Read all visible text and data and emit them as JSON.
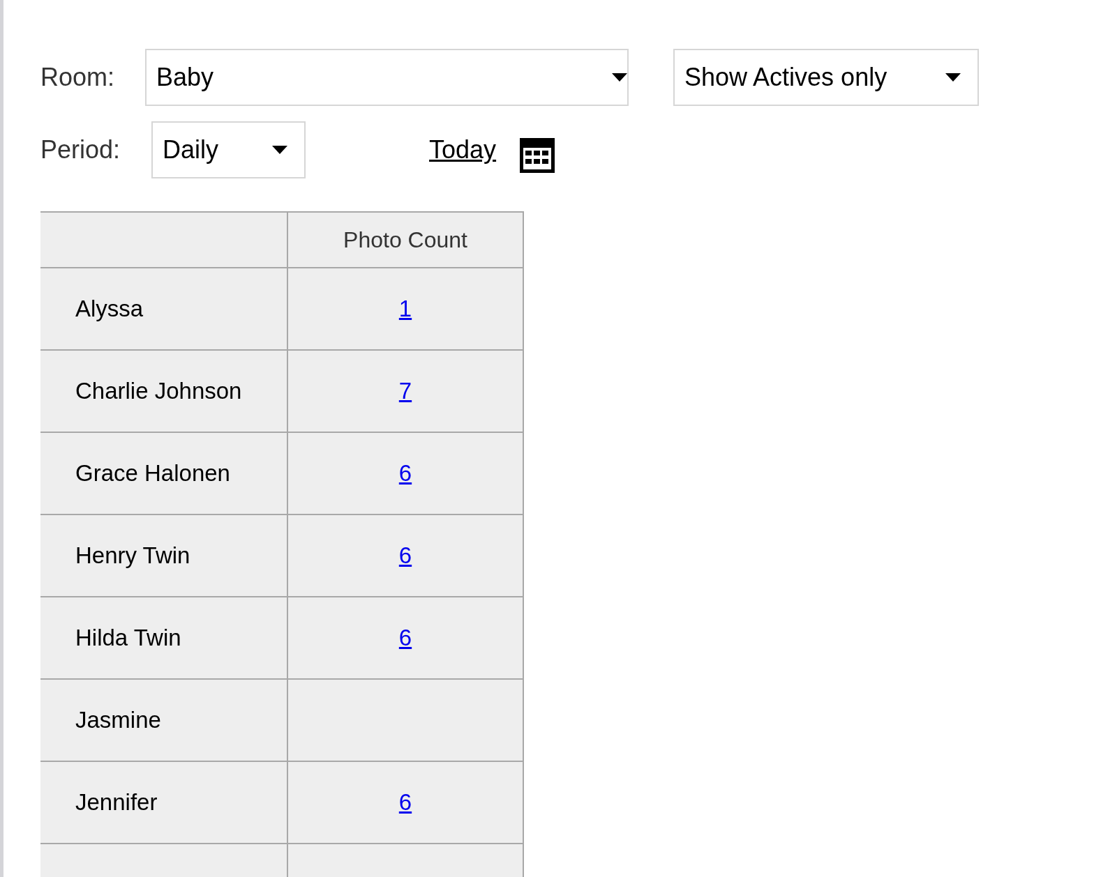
{
  "filters": {
    "room_label": "Room:",
    "room": "Baby",
    "status": "Show Actives only",
    "period_label": "Period:",
    "period": "Daily",
    "today_link": "Today"
  },
  "table": {
    "columns": [
      "Photo Count"
    ],
    "rows": [
      {
        "name": "Alyssa",
        "count": "1"
      },
      {
        "name": "Charlie Johnson",
        "count": "7"
      },
      {
        "name": "Grace Halonen",
        "count": "6"
      },
      {
        "name": "Henry Twin",
        "count": "6"
      },
      {
        "name": "Hilda Twin",
        "count": "6"
      },
      {
        "name": "Jasmine"
      },
      {
        "name": "Jennifer",
        "count": "6"
      }
    ]
  }
}
